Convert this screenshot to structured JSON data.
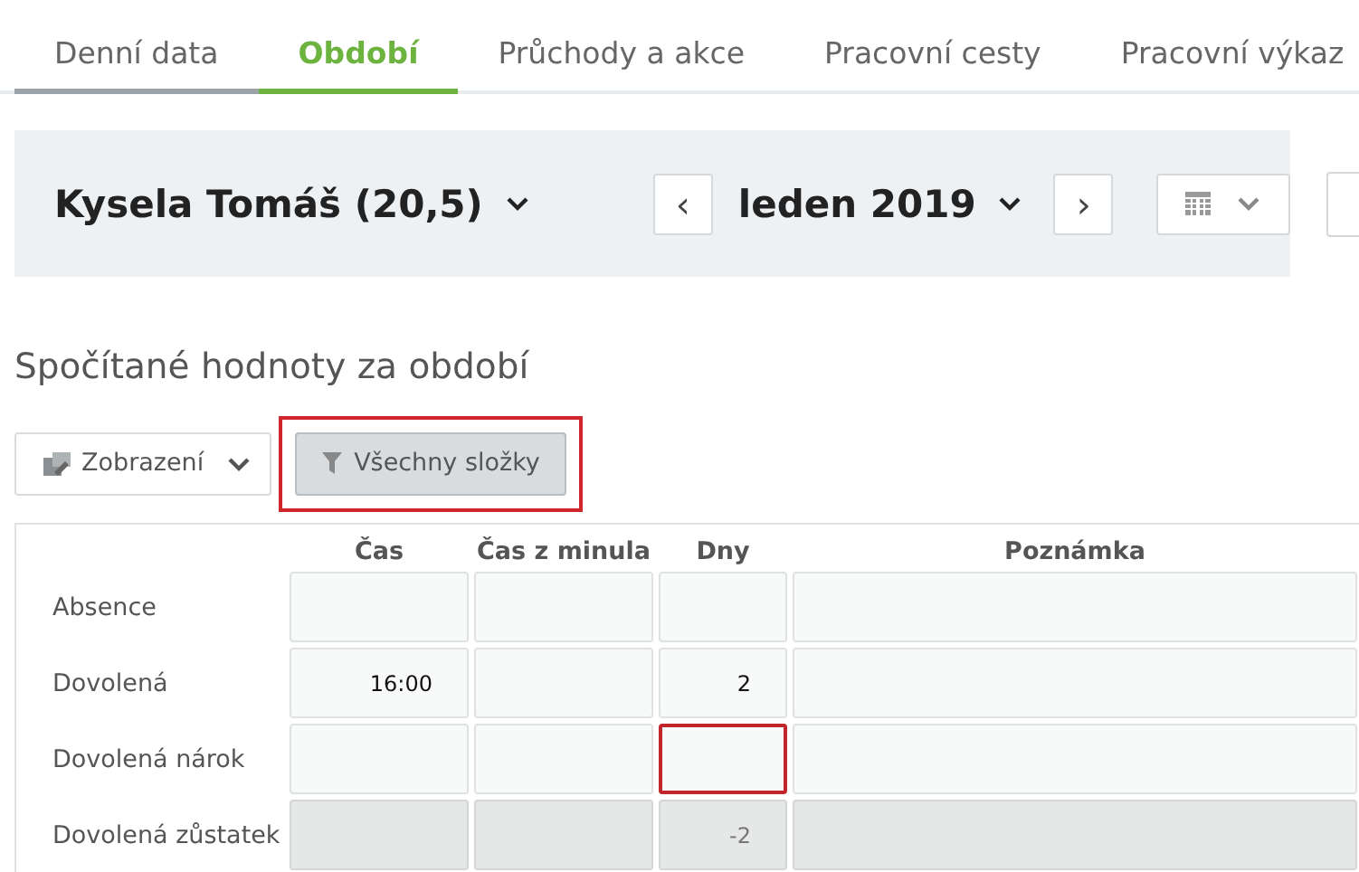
{
  "tabs": [
    {
      "label": "Denní data",
      "selected": false
    },
    {
      "label": "Období",
      "selected": true
    },
    {
      "label": "Průchody a akce",
      "selected": false
    },
    {
      "label": "Pracovní cesty",
      "selected": false
    },
    {
      "label": "Pracovní výkaz",
      "selected": false
    }
  ],
  "header": {
    "employee": "Kysela Tomáš (20,5)",
    "period": "leden 2019",
    "prev": "‹",
    "next": "›"
  },
  "section_title": "Spočítané hodnoty za období",
  "toolbar": {
    "view_button": "Zobrazení",
    "filter_button": {
      "label": "Všechny složky",
      "highlighted": true
    }
  },
  "table": {
    "columns": [
      "Čas",
      "Čas z minula",
      "Dny",
      "Poznámka"
    ],
    "rows": [
      {
        "label": "Absence",
        "cells": [
          {
            "readonly": false,
            "highlighted": false
          },
          {
            "readonly": false,
            "highlighted": false
          },
          {
            "readonly": false,
            "highlighted": false
          },
          {
            "readonly": false,
            "highlighted": false
          }
        ]
      },
      {
        "label": "Dovolená",
        "cells": [
          {
            "value": "16:00",
            "readonly": false,
            "highlighted": false
          },
          {
            "readonly": false,
            "highlighted": false
          },
          {
            "value": "2",
            "readonly": false,
            "highlighted": false
          },
          {
            "readonly": false,
            "highlighted": false
          }
        ]
      },
      {
        "label": "Dovolená nárok",
        "cells": [
          {
            "readonly": false,
            "highlighted": false
          },
          {
            "readonly": false,
            "highlighted": false
          },
          {
            "readonly": false,
            "highlighted": true
          },
          {
            "readonly": false,
            "highlighted": false
          }
        ]
      },
      {
        "label": "Dovolená zůstatek",
        "cells": [
          {
            "readonly": true,
            "highlighted": false
          },
          {
            "readonly": true,
            "highlighted": false
          },
          {
            "value": "-2",
            "readonly": true,
            "highlighted": false
          },
          {
            "readonly": true,
            "highlighted": false
          }
        ]
      }
    ]
  }
}
